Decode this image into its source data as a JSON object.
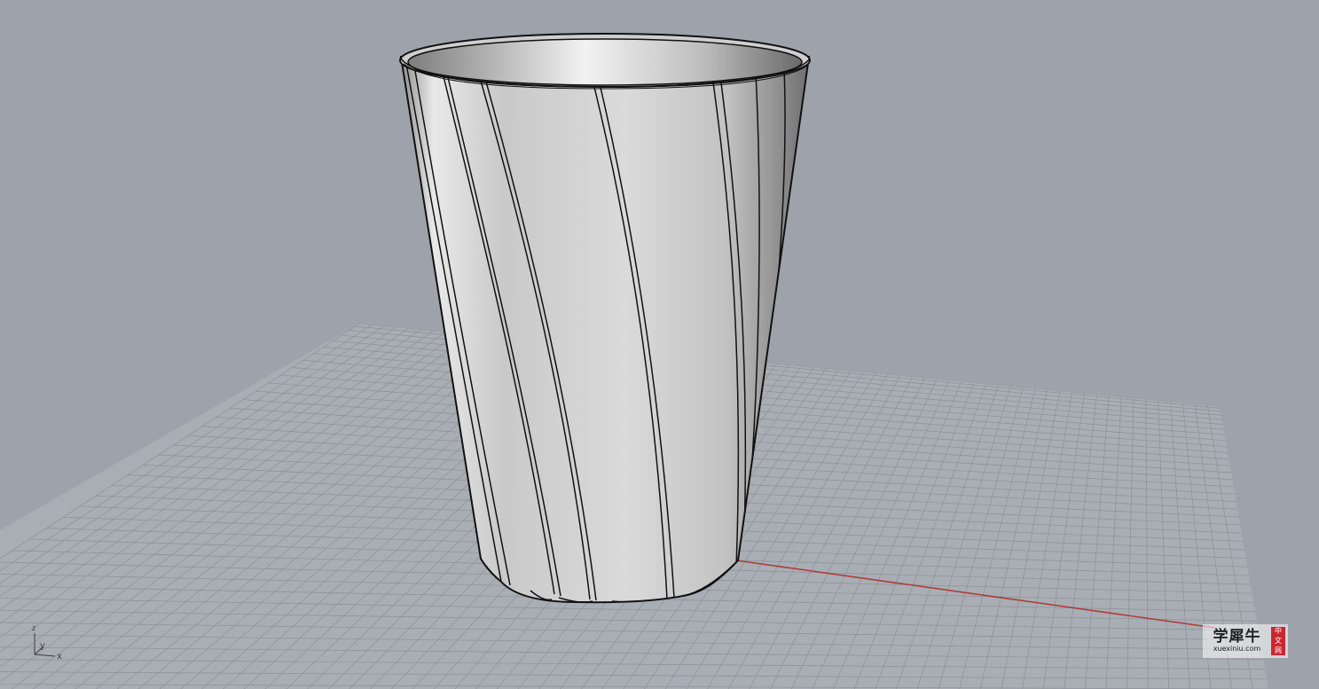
{
  "viewport": {
    "background_color": "#9ea3ab",
    "grid_color": "#a9adb4",
    "grid_line_color": "#8c9098",
    "x_axis_color": "#b03a36",
    "object_outline_color": "#111111"
  },
  "scene": {
    "object": "fluted-cup"
  },
  "axis_widget": {
    "z_label": "z",
    "y_label": "y",
    "x_label": "x"
  },
  "watermark": {
    "name": "学犀牛",
    "url": "xuexiniu.com",
    "seal_chars": [
      "中",
      "文",
      "网"
    ]
  }
}
